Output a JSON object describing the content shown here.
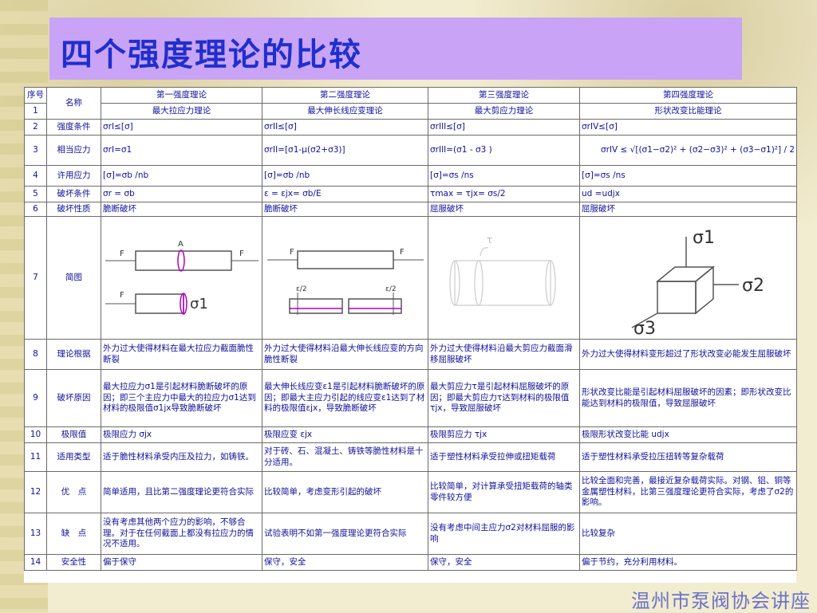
{
  "title": "四个强度理论的比较",
  "footer": "温州市泵阀协会讲座",
  "table": {
    "header_row": {
      "idx": "序号",
      "name": "名称",
      "theories": [
        "第一强度理论",
        "第二强度理论",
        "第三强度理论",
        "第四强度理论"
      ]
    },
    "rows": [
      {
        "idx": "1",
        "cells": [
          "最大拉应力理论",
          "最大伸长线应变理论",
          "最大剪应力理论",
          "形状改变比能理论"
        ]
      },
      {
        "idx": "2",
        "label": "强度条件",
        "cells": [
          "σrI≤[σ]",
          "σrII≤[σ]",
          "σrIII≤[σ]",
          "σrIV≤[σ]"
        ]
      },
      {
        "idx": "3",
        "label": "相当应力",
        "cells": [
          "σrI=σ1",
          "σrII=[σ1-μ(σ2+σ3)]",
          "σrIII=(σ1 - σ3 )",
          "σrIV ≤ √[(σ1−σ2)² + (σ2−σ3)² + (σ3−σ1)²] / 2"
        ]
      },
      {
        "idx": "4",
        "label": "许用应力",
        "cells": [
          "[σ]=σb /nb",
          "[σ]=σb /nb",
          "[σ]=σs /ns",
          "[σ]=σs /ns"
        ]
      },
      {
        "idx": "5",
        "label": "破坏条件",
        "cells": [
          "σr = σb",
          "ε = εjx= σb/E",
          "τmax = τjx= σs/2",
          "ud =udjx"
        ]
      },
      {
        "idx": "6",
        "label": "破坏性质",
        "cells": [
          "脆断破坏",
          "脆断破坏",
          "屈服破坏",
          "屈服破坏"
        ]
      },
      {
        "idx": "7",
        "label": "简图"
      },
      {
        "idx": "8",
        "label": "理论根据",
        "cells": [
          "外力过大使得材料在最大拉应力截面脆性断裂",
          "外力过大使得材料沿最大伸长线应变的方向脆性断裂",
          "外力过大使得材料沿最大剪应力截面滑移屈服破坏",
          "外力过大使得材料变形超过了形状改变必能发生屈服破坏"
        ]
      },
      {
        "idx": "9",
        "label": "破坏原因",
        "cells": [
          "最大拉应力σ1是引起材料脆断破坏的原因；即三个主应力中最大的拉应力σ1达到材料的极限值σ1jx导致脆断破坏",
          "最大伸长线应变ε1是引起材料脆断破坏的原因；即最大主应力引起的线应变ε1达到了材料的极限值εjx，导致脆断破坏",
          "最大剪应力τ是引起材料屈服破坏的原因；即最大剪应力τ达到材料的极限值τjx，导致屈服破坏",
          "形状改变比能是引起材料屈服破坏的因素；即形状改变比能达到材料的极限值，导致屈服破坏"
        ]
      },
      {
        "idx": "10",
        "label": "极限值",
        "cells": [
          "极限应力 σjx",
          "极限应变 εjx",
          "极限剪应力 τjx",
          "极限形状改变比能 udjx"
        ]
      },
      {
        "idx": "11",
        "label": "适用类型",
        "cells": [
          "适于脆性材料承受内压及拉力，如铸铁。",
          "对于砖、石、混凝土、铸铁等脆性材料是十分适用。",
          "适于塑性材料承受拉伸或扭矩载荷",
          "适于塑性材料承受拉压扭转等复杂载荷"
        ]
      },
      {
        "idx": "12",
        "label": "优　点",
        "cells": [
          "简单适用，且比第二强度理论更符合实际",
          "比较简单，考虑变形引起的破坏",
          "比较简单，对计算承受扭矩载荷的轴类零件较方便",
          "比较全面和完善，最接近复杂载荷实际。对钢、铝、铜等金属塑性材料，比第三强度理论更符合实际，考虑了σ2的影响。"
        ]
      },
      {
        "idx": "13",
        "label": "缺　点",
        "cells": [
          "没有考虑其他两个应力的影响，不够合理。对于在任何截面上都没有拉应力的情况不适用。",
          "试验表明不如第一强度理论更符合实际",
          "没有考虑中间主应力σ2对材料屈服的影响",
          "比较复杂"
        ]
      },
      {
        "idx": "14",
        "label": "安全性",
        "cells": [
          "偏于保守",
          "保守，安全",
          "保守，安全",
          "偏于节约，充分利用材料。"
        ]
      }
    ],
    "diagram_labels": {
      "force": "F",
      "section": "A",
      "sigma1": "σ1",
      "sigma2": "σ2",
      "sigma3": "σ3",
      "tau": "τ",
      "eps": "ε/2"
    }
  }
}
